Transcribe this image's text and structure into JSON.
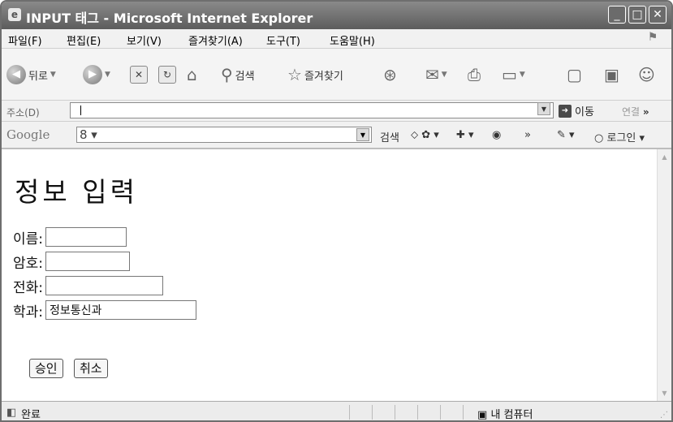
{
  "window": {
    "title": "INPUT 태그 - Microsoft Internet Explorer",
    "buttons": {
      "minimize": "_",
      "maximize": "□",
      "close": "✕"
    }
  },
  "menu": {
    "items": [
      "파일(F)",
      "편집(E)",
      "보기(V)",
      "즐겨찾기(A)",
      "도구(T)",
      "도움말(H)"
    ]
  },
  "toolbar": {
    "back": "뒤로",
    "search": "검색",
    "favorites": "즐겨찾기"
  },
  "address": {
    "label": "주소(D)",
    "value": "",
    "go": "이동",
    "links": "연결"
  },
  "google": {
    "logo": "Google",
    "search": "검색",
    "login": "로그인"
  },
  "page": {
    "heading": "정보 입력",
    "fields": [
      {
        "label": "이름:",
        "value": ""
      },
      {
        "label": "암호:",
        "value": ""
      },
      {
        "label": "전화:",
        "value": ""
      },
      {
        "label": "학과:",
        "value": "정보통신과"
      }
    ],
    "submit": "승인",
    "reset": "취소"
  },
  "status": {
    "text": "완료",
    "zone": "내 컴퓨터"
  }
}
